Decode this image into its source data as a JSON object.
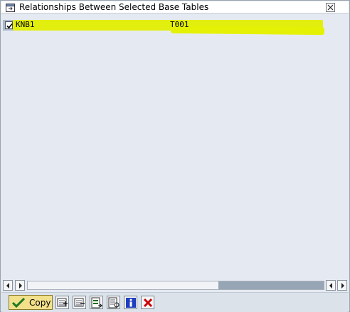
{
  "dialog": {
    "title": "Relationships Between Selected Base Tables"
  },
  "relationships": [
    {
      "checked": true,
      "source_table": "KNB1",
      "target_table": "T001"
    }
  ],
  "toolbar": {
    "copy_label": "Copy",
    "buttons": [
      {
        "icon": "select-all-icon"
      },
      {
        "icon": "deselect-all-icon"
      },
      {
        "icon": "select-block-icon"
      },
      {
        "icon": "details-icon"
      },
      {
        "icon": "info-icon"
      },
      {
        "icon": "cancel-icon"
      }
    ]
  },
  "colors": {
    "highlight": "#e2ef0e",
    "background": "#e5eaf2",
    "copy_button": "#f3e08a",
    "cancel_red": "#cc0000",
    "info_blue": "#1f3fbf"
  }
}
